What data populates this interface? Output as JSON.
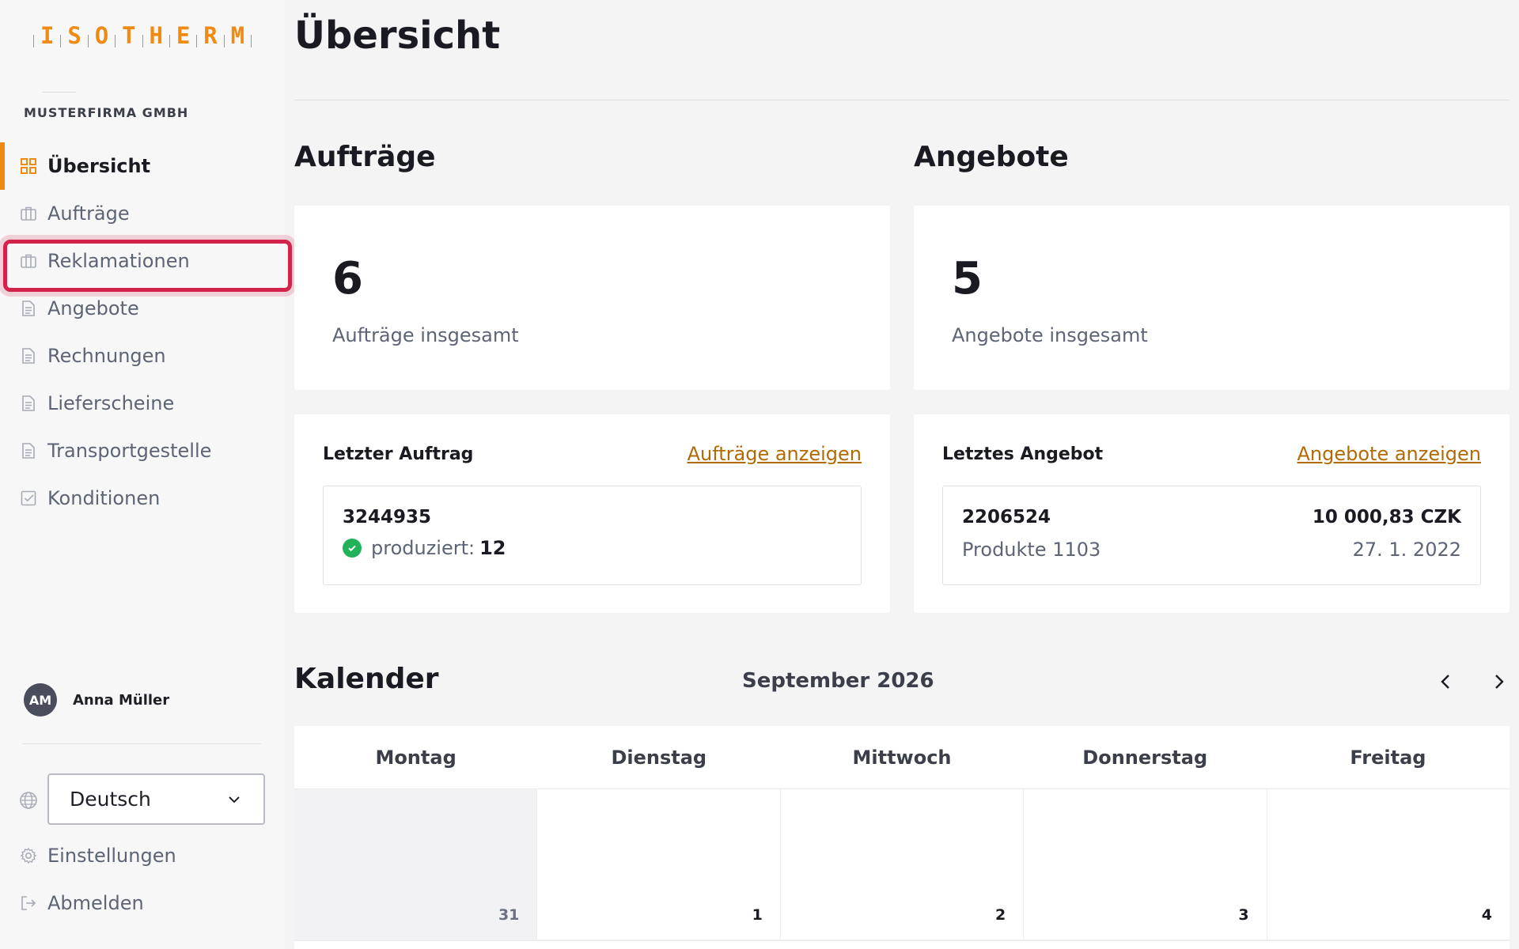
{
  "app": {
    "logo_letters": [
      "I",
      "S",
      "O",
      "T",
      "H",
      "E",
      "R",
      "M"
    ],
    "company": "MUSTERFIRMA GMBH",
    "brand_color": "#ef8a12",
    "highlight_color": "#d3234b"
  },
  "sidebar": {
    "items": [
      {
        "label": "Übersicht",
        "icon": "grid-icon",
        "active": true
      },
      {
        "label": "Aufträge",
        "icon": "briefcase-icon"
      },
      {
        "label": "Reklamationen",
        "icon": "briefcase-icon",
        "highlighted": true
      },
      {
        "label": "Angebote",
        "icon": "document-icon"
      },
      {
        "label": "Rechnungen",
        "icon": "document-icon"
      },
      {
        "label": "Lieferscheine",
        "icon": "document-icon"
      },
      {
        "label": "Transportgestelle",
        "icon": "document-icon"
      },
      {
        "label": "Konditionen",
        "icon": "checkbox-icon"
      }
    ],
    "user": {
      "initials": "AM",
      "name": "Anna Müller"
    },
    "language": {
      "selected": "Deutsch"
    },
    "settings_label": "Einstellungen",
    "logout_label": "Abmelden"
  },
  "main": {
    "title": "Übersicht",
    "orders": {
      "title": "Aufträge",
      "count": "6",
      "count_label": "Aufträge insgesamt",
      "last_label": "Letzter Auftrag",
      "link": "Aufträge anzeigen",
      "last": {
        "number": "3244935",
        "status_label": "produziert:",
        "status_value": "12"
      }
    },
    "offers": {
      "title": "Angebote",
      "count": "5",
      "count_label": "Angebote insgesamt",
      "last_label": "Letztes Angebot",
      "link": "Angebote anzeigen",
      "last": {
        "number": "2206524",
        "products": "Produkte 1103",
        "amount": "10 000,83 CZK",
        "date": "27. 1. 2022"
      }
    },
    "calendar": {
      "title": "Kalender",
      "month": "September 2026",
      "weekdays": [
        "Montag",
        "Dienstag",
        "Mittwoch",
        "Donnerstag",
        "Freitag"
      ],
      "days": [
        "31",
        "1",
        "2",
        "3",
        "4"
      ]
    }
  }
}
